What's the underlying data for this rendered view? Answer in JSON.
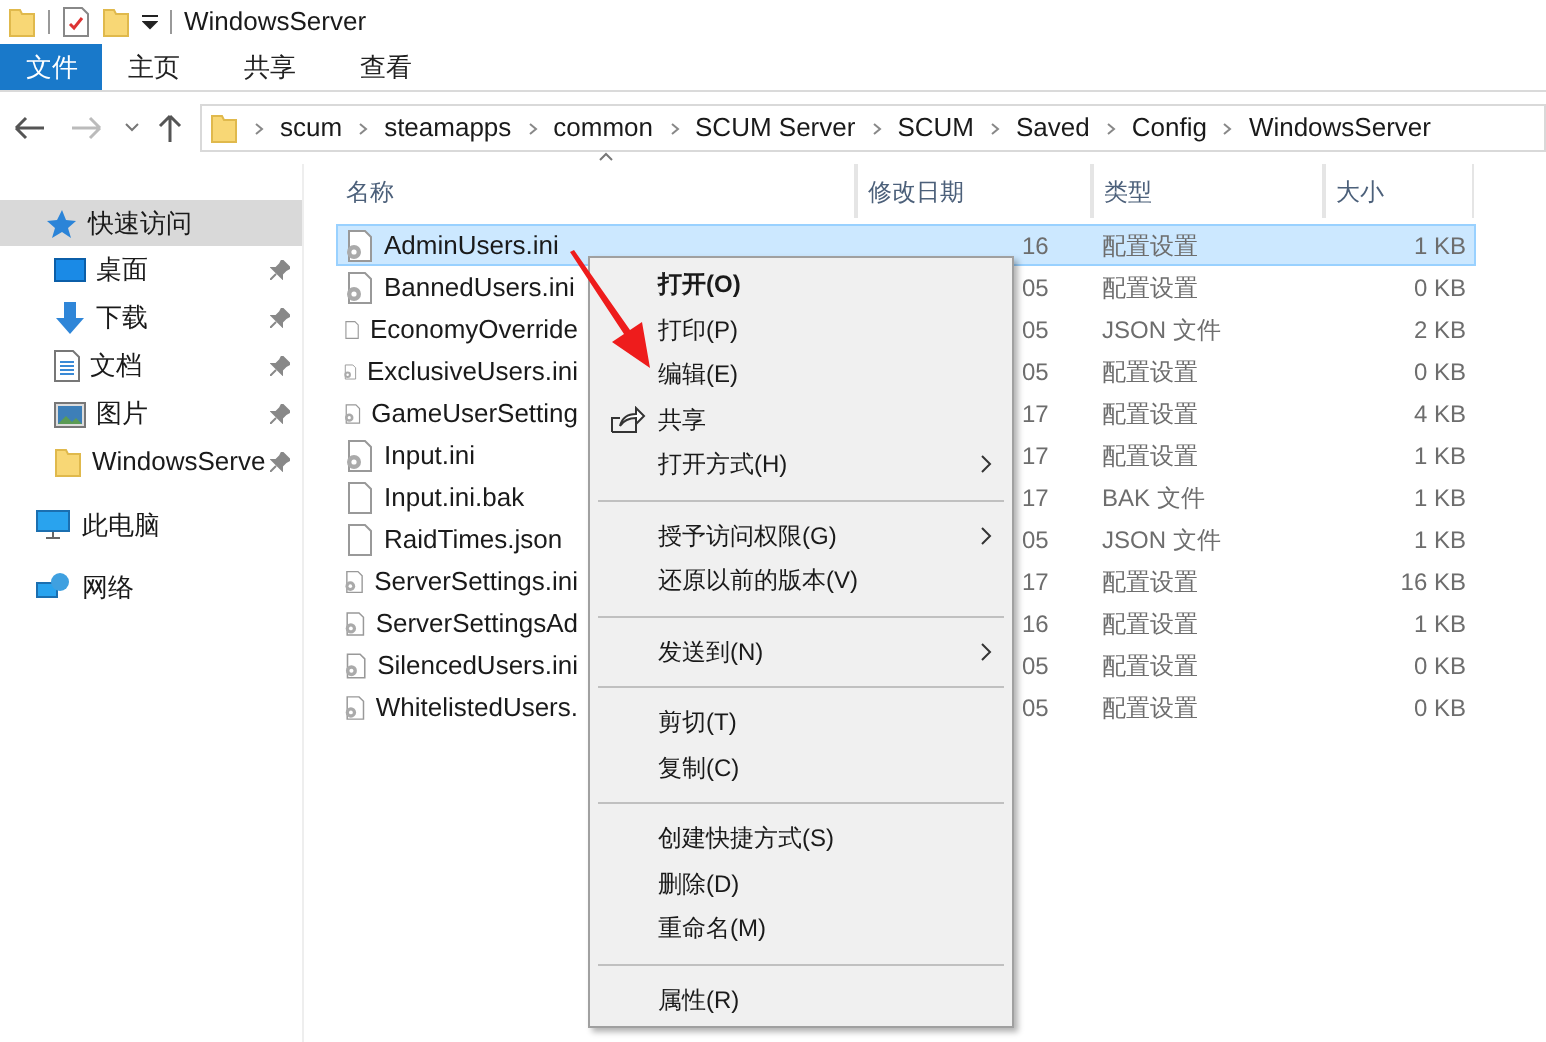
{
  "window": {
    "title": "WindowsServer"
  },
  "ribbon_tabs": [
    {
      "label": "文件",
      "selected": true
    },
    {
      "label": "主页",
      "selected": false
    },
    {
      "label": "共享",
      "selected": false
    },
    {
      "label": "查看",
      "selected": false
    }
  ],
  "breadcrumb": [
    "scum",
    "steamapps",
    "common",
    "SCUM Server",
    "SCUM",
    "Saved",
    "Config",
    "WindowsServer"
  ],
  "nav": [
    {
      "label": "快速访问",
      "kind": "quick",
      "selected": true,
      "children": [
        {
          "label": "桌面",
          "kind": "desktop",
          "pinned": true
        },
        {
          "label": "下载",
          "kind": "download",
          "pinned": true
        },
        {
          "label": "文档",
          "kind": "document",
          "pinned": true
        },
        {
          "label": "图片",
          "kind": "pictures",
          "pinned": true
        },
        {
          "label": "WindowsServe",
          "kind": "folder",
          "pinned": true
        }
      ]
    },
    {
      "label": "此电脑",
      "kind": "pc",
      "selected": false
    },
    {
      "label": "网络",
      "kind": "network",
      "selected": false
    }
  ],
  "table": {
    "columns": [
      "名称",
      "修改日期",
      "类型",
      "大小"
    ],
    "rows": [
      {
        "name": "AdminUsers.ini",
        "kind": "config",
        "date": "16",
        "type": "配置设置",
        "size": "1 KB",
        "selected": true
      },
      {
        "name": "BannedUsers.ini",
        "kind": "config",
        "date": "05",
        "type": "配置设置",
        "size": "0 KB",
        "selected": false
      },
      {
        "name": "EconomyOverride",
        "kind": "plain",
        "date": "05",
        "type": "JSON 文件",
        "size": "2 KB",
        "selected": false
      },
      {
        "name": "ExclusiveUsers.ini",
        "kind": "config",
        "date": "05",
        "type": "配置设置",
        "size": "0 KB",
        "selected": false
      },
      {
        "name": "GameUserSetting",
        "kind": "config",
        "date": "17",
        "type": "配置设置",
        "size": "4 KB",
        "selected": false
      },
      {
        "name": "Input.ini",
        "kind": "config",
        "date": "17",
        "type": "配置设置",
        "size": "1 KB",
        "selected": false
      },
      {
        "name": "Input.ini.bak",
        "kind": "plain",
        "date": "17",
        "type": "BAK 文件",
        "size": "1 KB",
        "selected": false
      },
      {
        "name": "RaidTimes.json",
        "kind": "plain",
        "date": "05",
        "type": "JSON 文件",
        "size": "1 KB",
        "selected": false
      },
      {
        "name": "ServerSettings.ini",
        "kind": "config",
        "date": "17",
        "type": "配置设置",
        "size": "16 KB",
        "selected": false
      },
      {
        "name": "ServerSettingsAd",
        "kind": "config",
        "date": "16",
        "type": "配置设置",
        "size": "1 KB",
        "selected": false
      },
      {
        "name": "SilencedUsers.ini",
        "kind": "config",
        "date": "05",
        "type": "配置设置",
        "size": "0 KB",
        "selected": false
      },
      {
        "name": "WhitelistedUsers.",
        "kind": "config",
        "date": "05",
        "type": "配置设置",
        "size": "0 KB",
        "selected": false
      }
    ]
  },
  "context_menu": [
    [
      {
        "label": "打开(O)",
        "default": true,
        "submenu": false,
        "kind": "plain"
      },
      {
        "label": "打印(P)",
        "default": false,
        "submenu": false,
        "kind": "plain"
      },
      {
        "label": "编辑(E)",
        "default": false,
        "submenu": false,
        "kind": "plain"
      },
      {
        "label": "共享",
        "default": false,
        "submenu": false,
        "kind": "share"
      },
      {
        "label": "打开方式(H)",
        "default": false,
        "submenu": true,
        "kind": "plain"
      }
    ],
    [
      {
        "label": "授予访问权限(G)",
        "default": false,
        "submenu": true,
        "kind": "plain"
      },
      {
        "label": "还原以前的版本(V)",
        "default": false,
        "submenu": false,
        "kind": "plain"
      }
    ],
    [
      {
        "label": "发送到(N)",
        "default": false,
        "submenu": true,
        "kind": "plain"
      }
    ],
    [
      {
        "label": "剪切(T)",
        "default": false,
        "submenu": false,
        "kind": "plain"
      },
      {
        "label": "复制(C)",
        "default": false,
        "submenu": false,
        "kind": "plain"
      }
    ],
    [
      {
        "label": "创建快捷方式(S)",
        "default": false,
        "submenu": false,
        "kind": "plain"
      },
      {
        "label": "删除(D)",
        "default": false,
        "submenu": false,
        "kind": "plain"
      },
      {
        "label": "重命名(M)",
        "default": false,
        "submenu": false,
        "kind": "plain"
      }
    ],
    [
      {
        "label": "属性(R)",
        "default": false,
        "submenu": false,
        "kind": "plain"
      }
    ]
  ]
}
